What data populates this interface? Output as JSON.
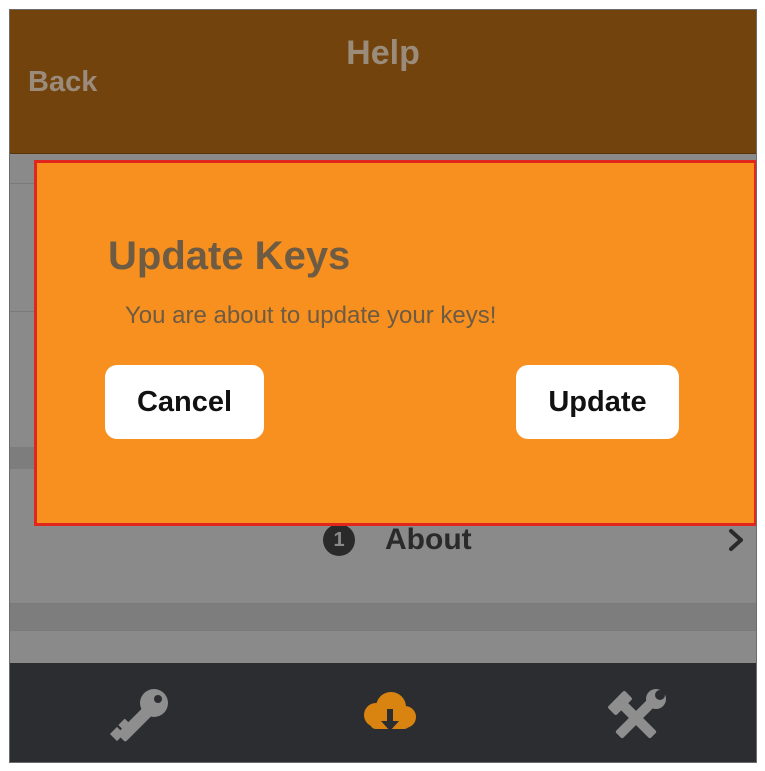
{
  "header": {
    "title": "Help",
    "back_label": "Back"
  },
  "list": {
    "about": {
      "badge": "1",
      "label": "About"
    }
  },
  "dialog": {
    "title": "Update Keys",
    "message": "You are about to update your keys!",
    "cancel_label": "Cancel",
    "update_label": "Update"
  },
  "tabbar": {
    "tabs": [
      {
        "icon": "key-icon",
        "active": false
      },
      {
        "icon": "cloud-download-icon",
        "active": true
      },
      {
        "icon": "tools-icon",
        "active": false
      }
    ]
  },
  "colors": {
    "header_bg": "#72430d",
    "dialog_bg": "#f7901e",
    "dialog_border": "#e0261d",
    "tabbar_bg": "#2b2d31",
    "active_tab": "#d98410",
    "inactive_tab": "#8e8e8e"
  }
}
